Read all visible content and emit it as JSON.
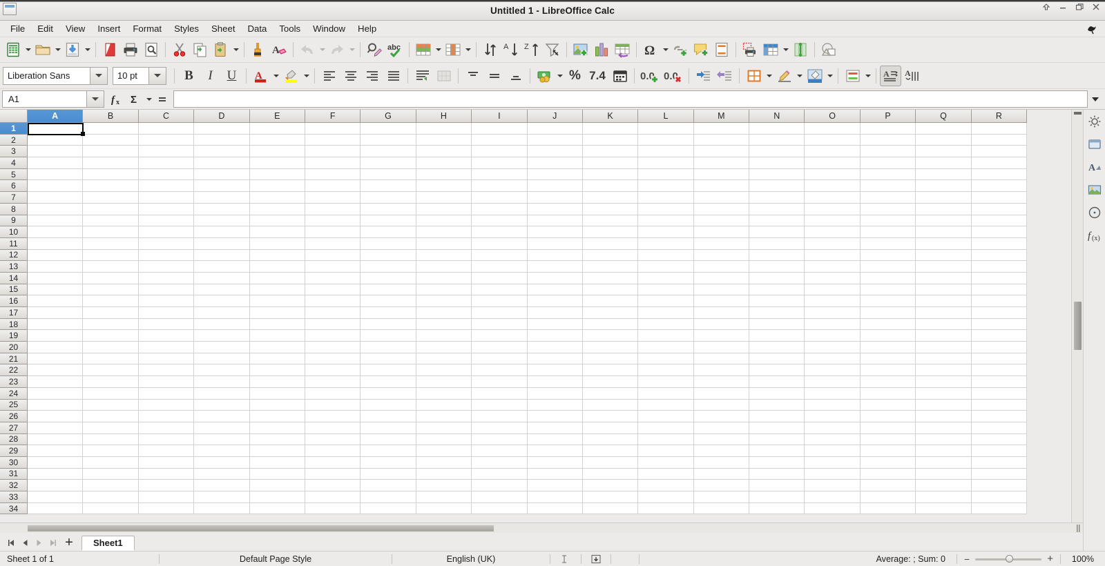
{
  "window": {
    "title": "Untitled 1 - LibreOffice Calc",
    "app_icon": "calc-document-icon",
    "controls": [
      {
        "name": "always-on-top-button",
        "glyph": "↑"
      },
      {
        "name": "minimize-button",
        "glyph": "–"
      },
      {
        "name": "restore-button",
        "glyph": "❐"
      },
      {
        "name": "close-button",
        "glyph": "✕"
      }
    ]
  },
  "menubar": {
    "items": [
      {
        "label": "File"
      },
      {
        "label": "Edit"
      },
      {
        "label": "View"
      },
      {
        "label": "Insert"
      },
      {
        "label": "Format"
      },
      {
        "label": "Styles"
      },
      {
        "label": "Sheet"
      },
      {
        "label": "Data"
      },
      {
        "label": "Tools"
      },
      {
        "label": "Window"
      },
      {
        "label": "Help"
      }
    ],
    "right_icon": "libreoffice-bird-icon"
  },
  "standard_toolbar": {
    "items": [
      {
        "name": "new-button",
        "icon": "new-document-icon"
      },
      {
        "name": "new-dropdown",
        "icon": "chevron-down-icon"
      },
      {
        "name": "open-button",
        "icon": "open-folder-icon"
      },
      {
        "name": "open-dropdown",
        "icon": "chevron-down-icon"
      },
      {
        "name": "save-button",
        "icon": "save-icon"
      },
      {
        "name": "save-dropdown",
        "icon": "chevron-down-icon"
      },
      {
        "name": "export-pdf-button",
        "icon": "pdf-icon"
      },
      {
        "name": "print-button",
        "icon": "printer-icon"
      },
      {
        "name": "print-preview-button",
        "icon": "print-preview-icon"
      },
      {
        "name": "cut-button",
        "icon": "scissors-icon"
      },
      {
        "name": "copy-button",
        "icon": "copy-icon"
      },
      {
        "name": "paste-button",
        "icon": "paste-icon"
      },
      {
        "name": "paste-dropdown",
        "icon": "chevron-down-icon"
      },
      {
        "name": "clone-formatting-button",
        "icon": "paintbrush-icon"
      },
      {
        "name": "clear-formatting-button",
        "icon": "clear-formatting-icon"
      },
      {
        "name": "undo-button",
        "icon": "undo-arrow-icon"
      },
      {
        "name": "undo-dropdown",
        "icon": "chevron-down-icon"
      },
      {
        "name": "redo-button",
        "icon": "redo-arrow-icon"
      },
      {
        "name": "redo-dropdown",
        "icon": "chevron-down-icon"
      },
      {
        "name": "find-replace-button",
        "icon": "find-replace-icon"
      },
      {
        "name": "spelling-button",
        "icon": "spellcheck-abc-icon"
      },
      {
        "name": "row-button",
        "icon": "insert-row-icon"
      },
      {
        "name": "row-dropdown",
        "icon": "chevron-down-icon"
      },
      {
        "name": "column-button",
        "icon": "insert-column-icon"
      },
      {
        "name": "column-dropdown",
        "icon": "chevron-down-icon"
      },
      {
        "name": "sort-button",
        "icon": "sort-icon"
      },
      {
        "name": "sort-ascending-button",
        "icon": "sort-ascending-icon"
      },
      {
        "name": "sort-descending-button",
        "icon": "sort-descending-icon"
      },
      {
        "name": "autofilter-button",
        "icon": "funnel-filter-icon"
      },
      {
        "name": "insert-image-button",
        "icon": "image-icon"
      },
      {
        "name": "insert-chart-button",
        "icon": "chart-bar-icon"
      },
      {
        "name": "pivot-table-button",
        "icon": "pivot-table-icon"
      },
      {
        "name": "special-character-button",
        "icon": "omega-icon"
      },
      {
        "name": "special-character-dropdown",
        "icon": "chevron-down-icon"
      },
      {
        "name": "insert-hyperlink-button",
        "icon": "link-icon"
      },
      {
        "name": "insert-comment-button",
        "icon": "comment-bubble-icon"
      },
      {
        "name": "headers-footers-button",
        "icon": "header-footer-icon"
      },
      {
        "name": "define-print-area-button",
        "icon": "print-area-icon"
      },
      {
        "name": "freeze-rows-columns-button",
        "icon": "freeze-panes-icon"
      },
      {
        "name": "freeze-dropdown",
        "icon": "chevron-down-icon"
      },
      {
        "name": "split-window-button",
        "icon": "split-window-icon"
      },
      {
        "name": "show-draw-functions-button",
        "icon": "draw-shapes-icon"
      }
    ]
  },
  "format_toolbar": {
    "font_name": "Liberation Sans",
    "font_size": "10 pt",
    "items": [
      {
        "name": "bold-button",
        "icon": "bold-icon",
        "label": "B"
      },
      {
        "name": "italic-button",
        "icon": "italic-icon",
        "label": "I"
      },
      {
        "name": "underline-button",
        "icon": "underline-icon",
        "label": "U"
      },
      {
        "name": "font-color-button",
        "icon": "font-color-icon",
        "color": "#c9211e"
      },
      {
        "name": "highlighting-color-button",
        "icon": "highlight-color-icon",
        "color": "#ffff00"
      },
      {
        "name": "align-left-button",
        "icon": "align-left-icon"
      },
      {
        "name": "align-center-button",
        "icon": "align-center-icon"
      },
      {
        "name": "align-right-button",
        "icon": "align-right-icon"
      },
      {
        "name": "justified-button",
        "icon": "align-justified-icon"
      },
      {
        "name": "wrap-text-button",
        "icon": "wrap-text-icon"
      },
      {
        "name": "merge-cells-button",
        "icon": "merge-cells-icon"
      },
      {
        "name": "align-top-button",
        "icon": "align-top-icon"
      },
      {
        "name": "center-vertically-button",
        "icon": "align-middle-icon"
      },
      {
        "name": "align-bottom-button",
        "icon": "align-bottom-icon"
      },
      {
        "name": "format-as-currency-button",
        "icon": "currency-icon"
      },
      {
        "name": "currency-dropdown",
        "icon": "chevron-down-icon"
      },
      {
        "name": "format-as-percent-button",
        "icon": "percent-icon",
        "label": "%"
      },
      {
        "name": "format-as-number-button",
        "icon": "number-format-icon",
        "label": "7.4"
      },
      {
        "name": "format-as-date-button",
        "icon": "calendar-icon"
      },
      {
        "name": "add-decimal-place-button",
        "icon": "add-decimal-icon"
      },
      {
        "name": "delete-decimal-place-button",
        "icon": "delete-decimal-icon"
      },
      {
        "name": "increase-indent-button",
        "icon": "increase-indent-icon"
      },
      {
        "name": "decrease-indent-button",
        "icon": "decrease-indent-icon"
      },
      {
        "name": "borders-button",
        "icon": "borders-icon"
      },
      {
        "name": "borders-dropdown",
        "icon": "chevron-down-icon"
      },
      {
        "name": "border-style-button",
        "icon": "border-style-pencil-icon"
      },
      {
        "name": "border-style-dropdown",
        "icon": "chevron-down-icon"
      },
      {
        "name": "background-color-button",
        "icon": "background-color-icon"
      },
      {
        "name": "background-color-dropdown",
        "icon": "chevron-down-icon"
      },
      {
        "name": "conditional-formatting-button",
        "icon": "conditional-format-icon"
      },
      {
        "name": "conditional-dropdown",
        "icon": "chevron-down-icon"
      },
      {
        "name": "styles-button",
        "icon": "paragraph-style-icon"
      },
      {
        "name": "insert-special-button",
        "icon": "sort-text-icon"
      }
    ]
  },
  "formula_bar": {
    "name_box": "A1",
    "function_wizard_icon": "fx-icon",
    "sum_icon": "sigma-icon",
    "formula_icon": "equals-icon",
    "input_line": "",
    "expand_icon": "chevron-down-icon"
  },
  "grid": {
    "columns": [
      "A",
      "B",
      "C",
      "D",
      "E",
      "F",
      "G",
      "H",
      "I",
      "J",
      "K",
      "L",
      "M",
      "N",
      "O",
      "P",
      "Q",
      "R"
    ],
    "rows": [
      1,
      2,
      3,
      4,
      5,
      6,
      7,
      8,
      9,
      10,
      11,
      12,
      13,
      14,
      15,
      16,
      17,
      18,
      19,
      20,
      21,
      22,
      23,
      24,
      25,
      26,
      27,
      28,
      29,
      30,
      31,
      32,
      33,
      34
    ],
    "selected_cell": "A1",
    "selected_column": "A",
    "selected_row": 1
  },
  "sheet_tabs": {
    "nav": [
      {
        "name": "first-sheet-button",
        "icon": "first-page-icon"
      },
      {
        "name": "previous-sheet-button",
        "icon": "previous-page-icon"
      },
      {
        "name": "next-sheet-button",
        "icon": "next-page-icon"
      },
      {
        "name": "last-sheet-button",
        "icon": "last-page-icon"
      }
    ],
    "add_label": "+",
    "tabs": [
      {
        "label": "Sheet1",
        "active": true
      }
    ]
  },
  "status_bar": {
    "sheet_count": "Sheet 1 of 1",
    "page_style": "Default Page Style",
    "language": "English (UK)",
    "insert_mode_icon": "text-insert-mode-icon",
    "selection_mode_icon": "selection-mode-icon",
    "modified_icon": "document-modified-icon",
    "signature": "",
    "summary": "Average: ; Sum: 0",
    "zoom_out_label": "−",
    "zoom_in_label": "+",
    "zoom_level": "100%"
  },
  "sidebar": {
    "items": [
      {
        "name": "sidebar-settings-button",
        "icon": "sidebar-settings-gear-icon"
      },
      {
        "name": "sidebar-properties-button",
        "icon": "properties-panel-icon"
      },
      {
        "name": "sidebar-styles-button",
        "icon": "styles-A-icon"
      },
      {
        "name": "sidebar-gallery-button",
        "icon": "gallery-images-icon"
      },
      {
        "name": "sidebar-navigator-button",
        "icon": "navigator-compass-icon"
      },
      {
        "name": "sidebar-functions-button",
        "icon": "functions-fx-icon"
      }
    ]
  }
}
